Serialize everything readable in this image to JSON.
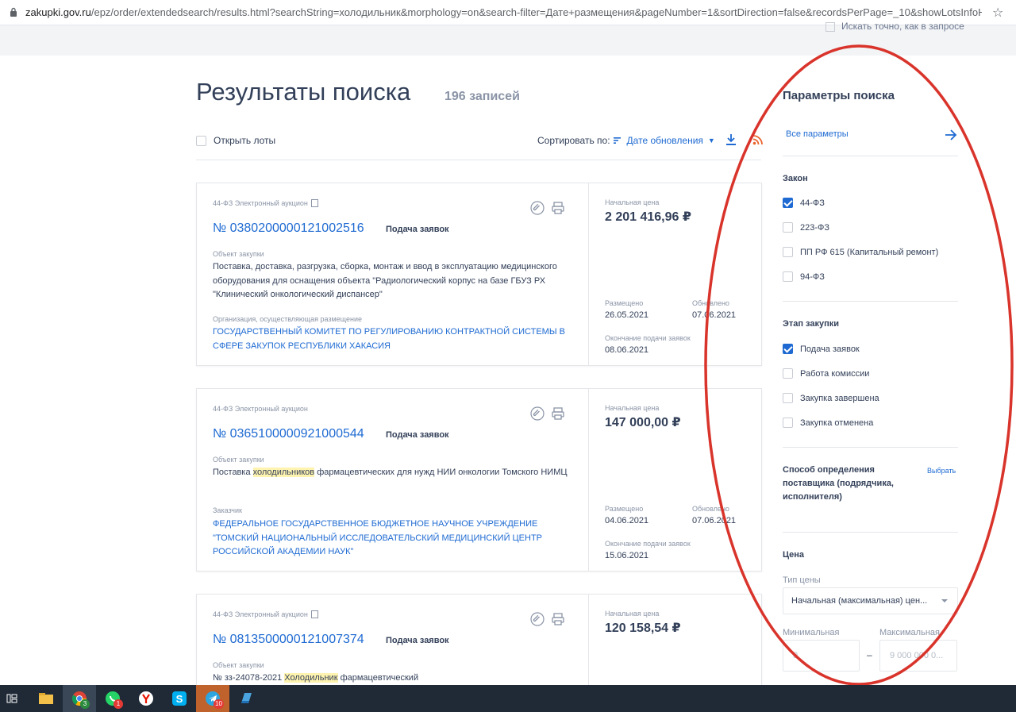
{
  "browser": {
    "url_domain": "zakupki.gov.ru",
    "url_rest": "/epz/order/extendedsearch/results.html?searchString=холодильник&morphology=on&search-filter=Дате+размещения&pageNumber=1&sortDirection=false&recordsPerPage=_10&showLotsInfoHidden=false..."
  },
  "top_band": {
    "hidden_option": "Искать точно, как в запросе"
  },
  "header": {
    "title": "Результаты поиска",
    "count": "196 записей"
  },
  "toolbar": {
    "open_lots": "Открыть лоты",
    "sort_label": "Сортировать по:",
    "sort_value": "Дате обновления"
  },
  "cards": [
    {
      "law": "44-ФЗ Электронный аукцион",
      "number": "№ 0380200000121002516",
      "stage": "Подача заявок",
      "object_label": "Объект закупки",
      "object_parts": [
        "Поставка, доставка, разгрузка, сборка, монтаж и ввод в эксплуатацию медицинского оборудования для оснащения объекта \"Радиологический корпус на базе ГБУЗ РХ \"Клинический онкологический диспансер\"",
        "",
        ""
      ],
      "org_label": "Организация, осуществляющая размещение",
      "org": "ГОСУДАРСТВЕННЫЙ КОМИТЕТ ПО РЕГУЛИРОВАНИЮ КОНТРАКТНОЙ СИСТЕМЫ В СФЕРЕ ЗАКУПОК РЕСПУБЛИКИ ХАКАСИЯ",
      "price_label": "Начальная цена",
      "price": "2 201 416,96 ₽",
      "placed_label": "Размещено",
      "placed": "26.05.2021",
      "updated_label": "Обновлено",
      "updated": "07.06.2021",
      "deadline_label": "Окончание подачи заявок",
      "deadline": "08.06.2021"
    },
    {
      "law": "44-ФЗ Электронный аукцион",
      "number": "№ 0365100000921000544",
      "stage": "Подача заявок",
      "object_label": "Объект закупки",
      "object_parts": [
        "Поставка ",
        "холодильников",
        " фармацевтических для нужд НИИ онкологии Томского НИМЦ"
      ],
      "org_label": "Заказчик",
      "org": "ФЕДЕРАЛЬНОЕ ГОСУДАРСТВЕННОЕ БЮДЖЕТНОЕ НАУЧНОЕ УЧРЕЖДЕНИЕ \"ТОМСКИЙ НАЦИОНАЛЬНЫЙ ИССЛЕДОВАТЕЛЬСКИЙ МЕДИЦИНСКИЙ ЦЕНТР РОССИЙСКОЙ АКАДЕМИИ НАУК\"",
      "price_label": "Начальная цена",
      "price": "147 000,00 ₽",
      "placed_label": "Размещено",
      "placed": "04.06.2021",
      "updated_label": "Обновлено",
      "updated": "07.06.2021",
      "deadline_label": "Окончание подачи заявок",
      "deadline": "15.06.2021"
    },
    {
      "law": "44-ФЗ Электронный аукцион",
      "number": "№ 0813500000121007374",
      "stage": "Подача заявок",
      "object_label": "Объект закупки",
      "object_parts": [
        "№ зз-24078-2021 ",
        "Холодильник",
        " фармацевтический"
      ],
      "price_label": "Начальная цена",
      "price": "120 158,54 ₽"
    }
  ],
  "sidebar": {
    "title": "Параметры поиска",
    "all_params": "Все параметры",
    "law_title": "Закон",
    "law_options": [
      {
        "label": "44-ФЗ",
        "checked": true
      },
      {
        "label": "223-ФЗ",
        "checked": false
      },
      {
        "label": "ПП РФ 615 (Капитальный ремонт)",
        "checked": false
      },
      {
        "label": "94-ФЗ",
        "checked": false
      }
    ],
    "stage_title": "Этап закупки",
    "stage_options": [
      {
        "label": "Подача заявок",
        "checked": true
      },
      {
        "label": "Работа комиссии",
        "checked": false
      },
      {
        "label": "Закупка завершена",
        "checked": false
      },
      {
        "label": "Закупка отменена",
        "checked": false
      }
    ],
    "method_title": "Способ определения поставщика (подрядчика, исполнителя)",
    "method_choose": "Выбрать",
    "price_title": "Цена",
    "price_type_label": "Тип цены",
    "price_type_value": "Начальная (максимальная) цен...",
    "min_label": "Минимальная",
    "min_placeholder": "0",
    "max_label": "Максимальная",
    "max_placeholder": "9 000 000 0..."
  },
  "taskbar": {
    "badges": {
      "chrome": "3",
      "whatsapp": "1",
      "telegram": "10"
    }
  },
  "colors": {
    "accent": "#1e6ad2",
    "annotation": "#d9342b",
    "text": "#334059",
    "muted": "#8a94a6"
  }
}
